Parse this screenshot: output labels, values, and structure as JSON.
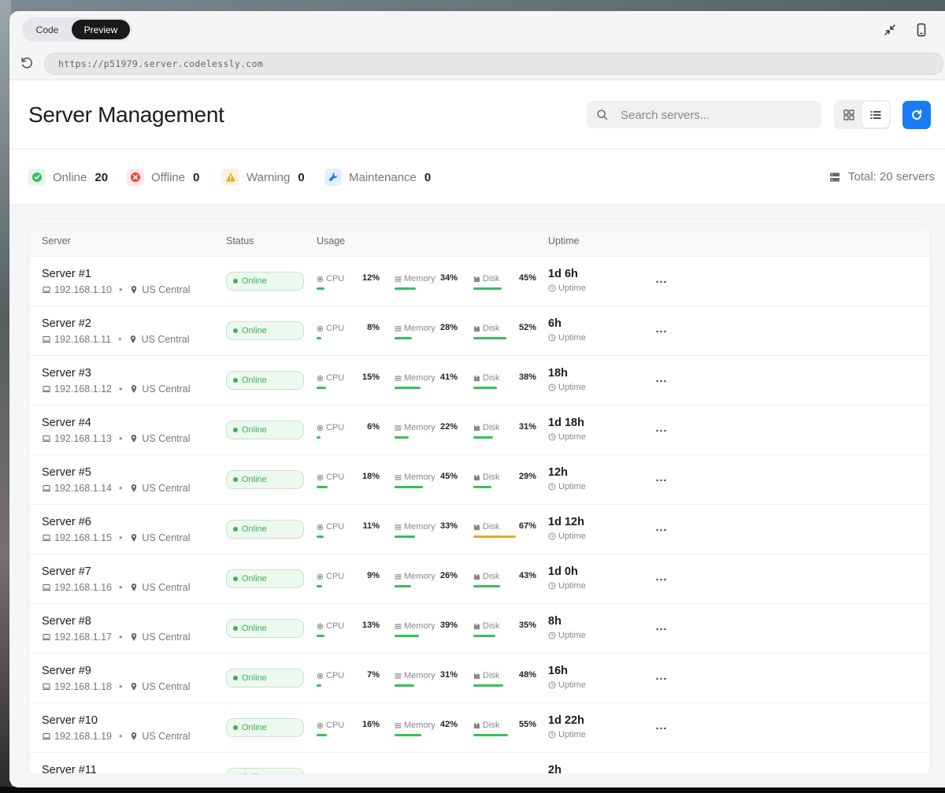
{
  "chrome": {
    "code_label": "Code",
    "preview_label": "Preview",
    "url": "https://p51979.server.codelessly.com"
  },
  "header": {
    "title": "Server Management",
    "search_placeholder": "Search servers..."
  },
  "status_summary": {
    "online": {
      "label": "Online",
      "count": "20",
      "color": "#34c15b"
    },
    "offline": {
      "label": "Offline",
      "count": "0",
      "color": "#e5483f"
    },
    "warning": {
      "label": "Warning",
      "count": "0",
      "color": "#f0a321"
    },
    "maintenance": {
      "label": "Maintenance",
      "count": "0",
      "color": "#1a7cf5"
    },
    "total": "Total: 20 servers"
  },
  "table": {
    "headers": {
      "server": "Server",
      "status": "Status",
      "usage": "Usage",
      "uptime": "Uptime"
    },
    "labels": {
      "cpu": "CPU",
      "memory": "Memory",
      "disk": "Disk",
      "uptime": "Uptime"
    },
    "rows": [
      {
        "name": "Server #1",
        "ip": "192.168.1.10",
        "region": "US Central",
        "status": "Online",
        "cpu": 12,
        "memory": 34,
        "disk": 45,
        "uptime": "1d 6h"
      },
      {
        "name": "Server #2",
        "ip": "192.168.1.11",
        "region": "US Central",
        "status": "Online",
        "cpu": 8,
        "memory": 28,
        "disk": 52,
        "uptime": "6h"
      },
      {
        "name": "Server #3",
        "ip": "192.168.1.12",
        "region": "US Central",
        "status": "Online",
        "cpu": 15,
        "memory": 41,
        "disk": 38,
        "uptime": "18h"
      },
      {
        "name": "Server #4",
        "ip": "192.168.1.13",
        "region": "US Central",
        "status": "Online",
        "cpu": 6,
        "memory": 22,
        "disk": 31,
        "uptime": "1d 18h"
      },
      {
        "name": "Server #5",
        "ip": "192.168.1.14",
        "region": "US Central",
        "status": "Online",
        "cpu": 18,
        "memory": 45,
        "disk": 29,
        "uptime": "12h"
      },
      {
        "name": "Server #6",
        "ip": "192.168.1.15",
        "region": "US Central",
        "status": "Online",
        "cpu": 11,
        "memory": 33,
        "disk": 67,
        "uptime": "1d 12h"
      },
      {
        "name": "Server #7",
        "ip": "192.168.1.16",
        "region": "US Central",
        "status": "Online",
        "cpu": 9,
        "memory": 26,
        "disk": 43,
        "uptime": "1d 0h"
      },
      {
        "name": "Server #8",
        "ip": "192.168.1.17",
        "region": "US Central",
        "status": "Online",
        "cpu": 13,
        "memory": 39,
        "disk": 35,
        "uptime": "8h"
      },
      {
        "name": "Server #9",
        "ip": "192.168.1.18",
        "region": "US Central",
        "status": "Online",
        "cpu": 7,
        "memory": 31,
        "disk": 48,
        "uptime": "16h"
      },
      {
        "name": "Server #10",
        "ip": "192.168.1.19",
        "region": "US Central",
        "status": "Online",
        "cpu": 16,
        "memory": 42,
        "disk": 55,
        "uptime": "1d 22h"
      },
      {
        "name": "Server #11",
        "ip": "",
        "region": "",
        "status": "Online",
        "cpu": null,
        "memory": null,
        "disk": null,
        "uptime": "2h"
      }
    ]
  }
}
